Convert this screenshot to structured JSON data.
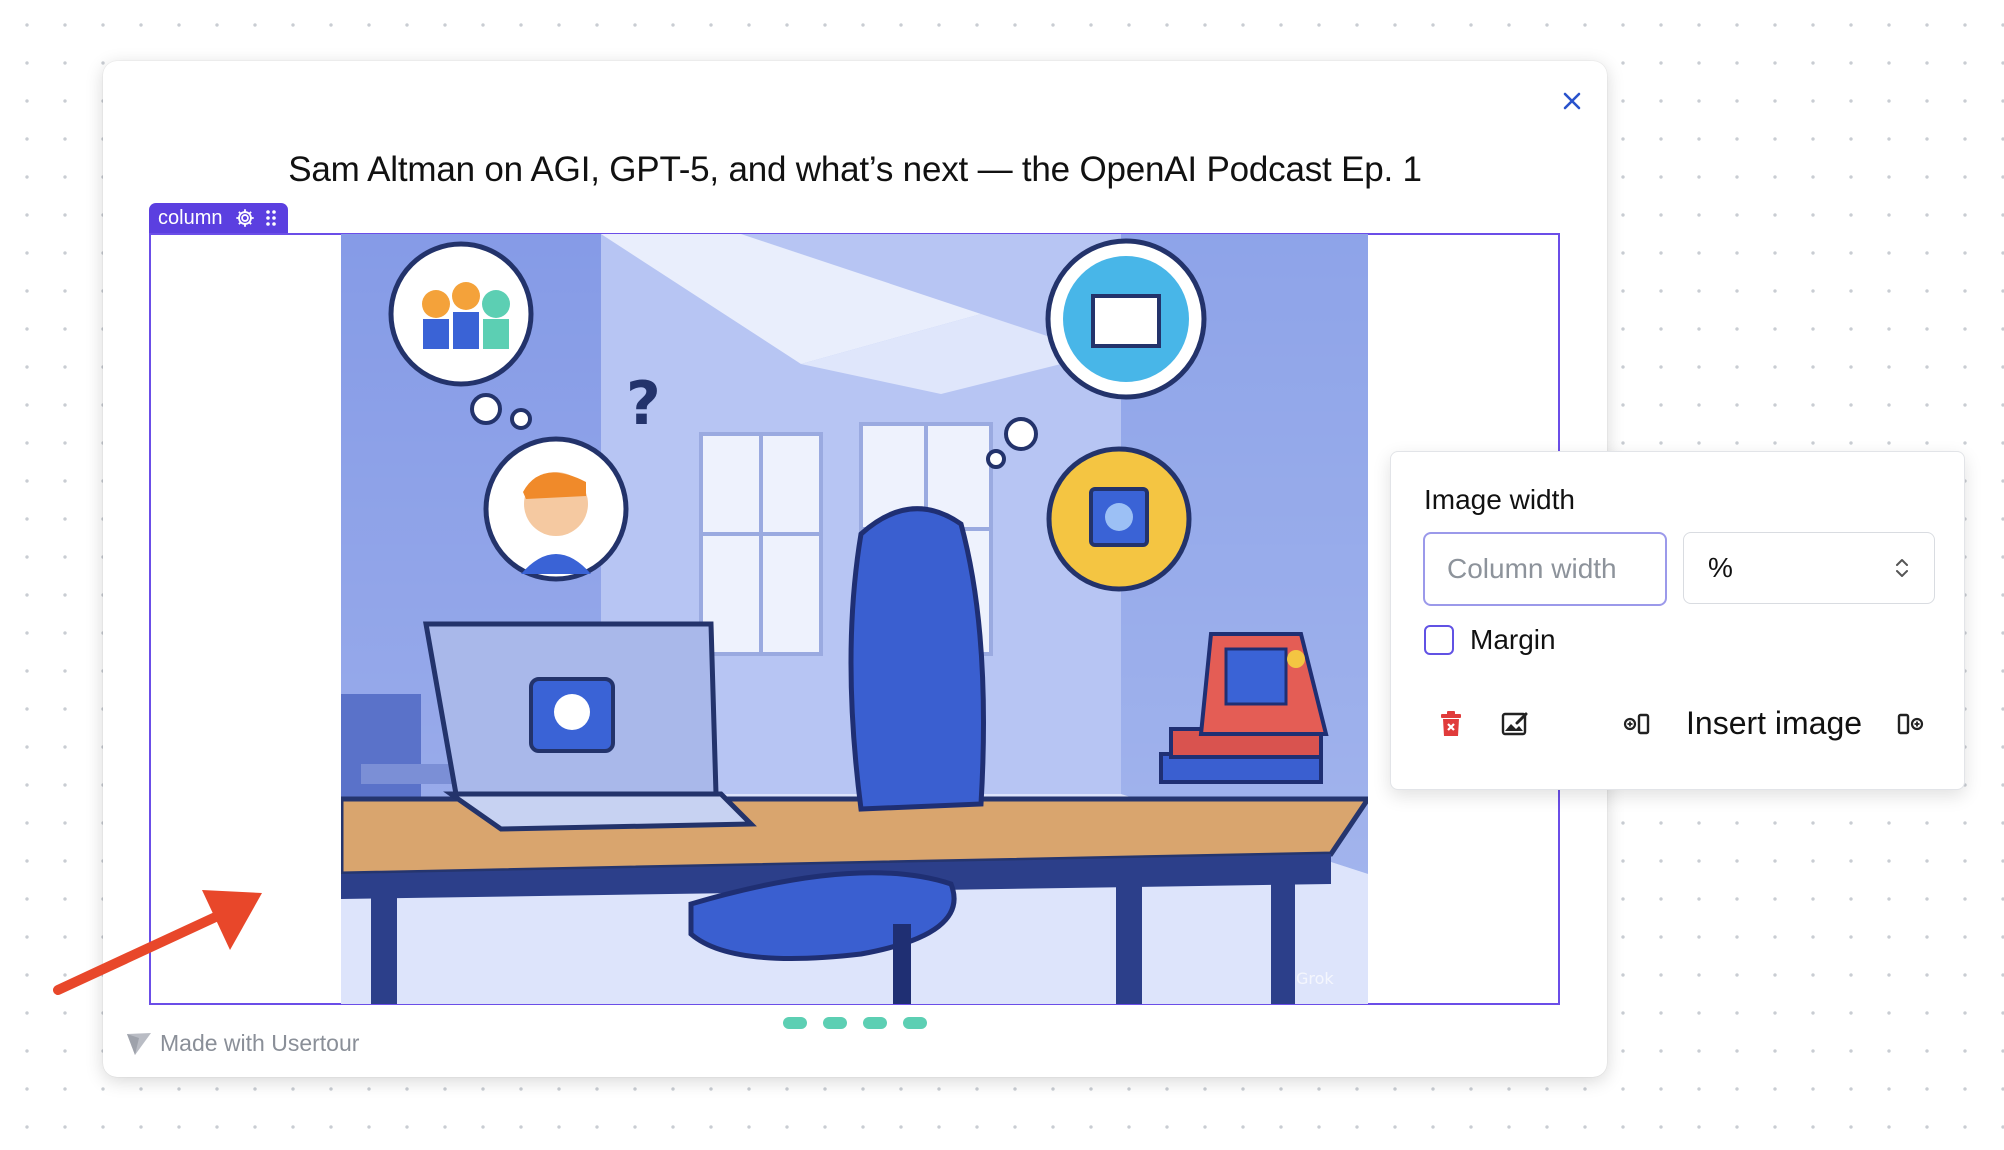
{
  "modal": {
    "title": "Sam Altman on AGI, GPT-5, and what’s next — the OpenAI Podcast Ep. 1",
    "close_icon": "close-icon"
  },
  "column_tag": {
    "label": "column",
    "settings_icon": "gear-icon",
    "drag_icon": "drag-handle-icon"
  },
  "image": {
    "alt": "Illustration of an office desk with a laptop, blue chair and thought bubbles",
    "watermark": "Grok"
  },
  "carousel": {
    "dot_count": 4
  },
  "branding": {
    "text": "Made with Usertour",
    "icon": "usertour-logo-icon"
  },
  "image_settings": {
    "label": "Image width",
    "width_input": {
      "value": "",
      "placeholder": "Column width"
    },
    "unit_select": {
      "selected": "%"
    },
    "margin": {
      "label": "Margin",
      "checked": false
    },
    "toolbar": {
      "delete_icon": "delete-icon",
      "replace_image_icon": "replace-image-icon",
      "insert_left_icon": "insert-left-icon",
      "insert_label": "Insert image",
      "insert_right_icon": "insert-right-icon"
    }
  },
  "colors": {
    "accent": "#5b3fe0",
    "dots": "#5ccfb3",
    "annotation_arrow": "#e8472a",
    "close_icon": "#2952cc",
    "delete_icon": "#e03b3b"
  }
}
